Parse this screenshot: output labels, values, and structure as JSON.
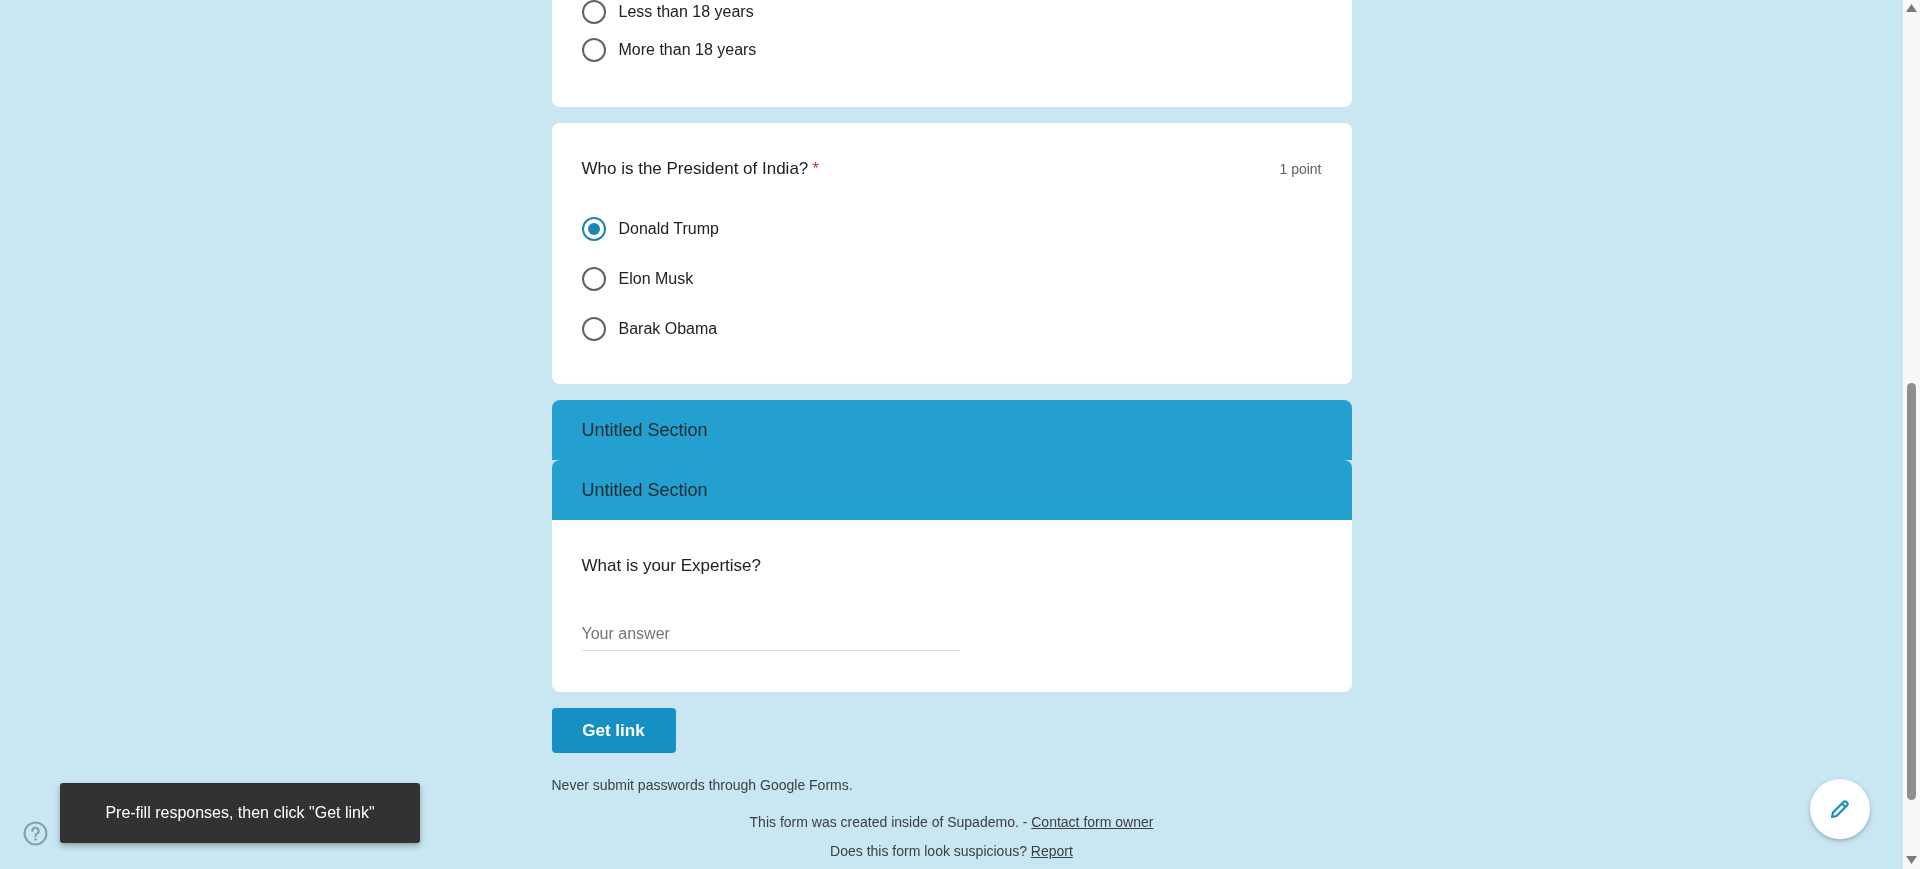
{
  "items": [
    {
      "kind": "choice",
      "options": [
        {
          "label": "Less than 18 years",
          "selected": false
        },
        {
          "label": "More than 18 years",
          "selected": false
        }
      ]
    },
    {
      "kind": "choice",
      "title": "Who is the President of India?",
      "required_mark": "*",
      "points": "1 point",
      "options": [
        {
          "label": "Donald Trump",
          "selected": true
        },
        {
          "label": "Elon Musk",
          "selected": false
        },
        {
          "label": "Barak Obama",
          "selected": false
        }
      ]
    },
    {
      "kind": "section",
      "title": "Untitled Section"
    },
    {
      "kind": "section",
      "title": "Untitled Section",
      "questions": [
        {
          "kind": "short_answer",
          "title": "What is your Expertise?",
          "placeholder": "Your answer"
        }
      ]
    }
  ],
  "submit_button": "Get link",
  "notice": "Never submit passwords through Google Forms.",
  "footer": {
    "created_text": "This form was created inside of Supademo. - ",
    "contact_link": "Contact form owner",
    "suspicious_text": "Does this form look suspicious? ",
    "report_link": "Report"
  },
  "toast": "Pre-fill responses, then click \"Get link\""
}
